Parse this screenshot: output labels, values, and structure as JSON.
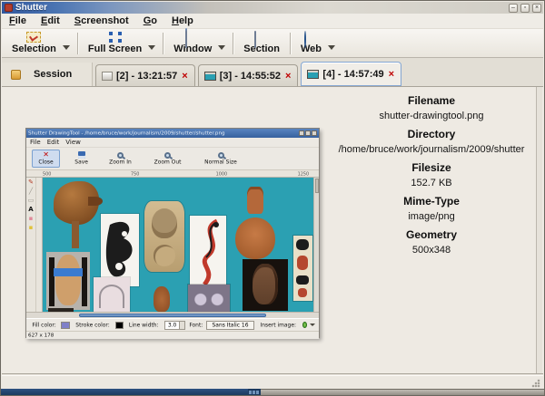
{
  "titlebar": {
    "title": "Shutter",
    "minimize": "–",
    "maximize": "▫",
    "close": "×"
  },
  "menubar": {
    "items": [
      "File",
      "Edit",
      "Screenshot",
      "Go",
      "Help"
    ]
  },
  "toolbar": {
    "buttons": [
      {
        "label": "Selection",
        "icon": "selection-icon",
        "dropdown": true
      },
      {
        "label": "Full Screen",
        "icon": "fullscreen-icon",
        "dropdown": true
      },
      {
        "label": "Window",
        "icon": "window-icon",
        "dropdown": true
      },
      {
        "label": "Section",
        "icon": "section-icon",
        "dropdown": false
      },
      {
        "label": "Web",
        "icon": "web-icon",
        "dropdown": true
      }
    ]
  },
  "tabbar": {
    "session_label": "Session",
    "close_glyph": "×",
    "tabs": [
      {
        "label": "[2] - 13:21:57"
      },
      {
        "label": "[3] - 14:55:52"
      },
      {
        "label": "[4] - 14:57:49",
        "active": true
      }
    ]
  },
  "details": {
    "fields": [
      {
        "label": "Filename",
        "value": "shutter-drawingtool.png"
      },
      {
        "label": "Directory",
        "value": "/home/bruce/work/journalism/2009/shutter"
      },
      {
        "label": "Filesize",
        "value": "152.7 KB"
      },
      {
        "label": "Mime-Type",
        "value": "image/png"
      },
      {
        "label": "Geometry",
        "value": "500x348"
      }
    ]
  },
  "preview": {
    "title": "Shutter DrawingTool - /home/bruce/work/journalism/2009/shutter/shutter.png",
    "menu": [
      "File",
      "Edit",
      "View"
    ],
    "toolbar": [
      {
        "label": "Close"
      },
      {
        "label": "Save"
      },
      {
        "label": "Zoom In"
      },
      {
        "label": "Zoom Out"
      },
      {
        "label": "Normal Size"
      }
    ],
    "ruler": [
      "500",
      "750",
      "1000",
      "1250"
    ],
    "tools": [
      {
        "name": "pencil",
        "glyph": "✎"
      },
      {
        "name": "line",
        "glyph": "╱"
      },
      {
        "name": "rectangle",
        "glyph": "▭"
      },
      {
        "name": "text",
        "glyph": "A"
      },
      {
        "name": "eraser",
        "glyph": "▪"
      },
      {
        "name": "highlighter",
        "glyph": "▪"
      }
    ],
    "controls": {
      "fill_label": "Fill color:",
      "stroke_label": "Stroke color:",
      "line_width_label": "Line width:",
      "line_width_value": "3.0",
      "font_label": "Font:",
      "font_value": "Sans Italic 16",
      "insert_label": "Insert image:"
    },
    "status": "627 x 178",
    "colors": {
      "canvas": "#2ba0b2",
      "fill_swatch": "#8080c8",
      "stroke_swatch": "#000000"
    }
  },
  "colors": {
    "titlebar_blue": "#3a66aa",
    "tab_close_red": "#c00000",
    "active_tab_border": "#84a6d2"
  }
}
